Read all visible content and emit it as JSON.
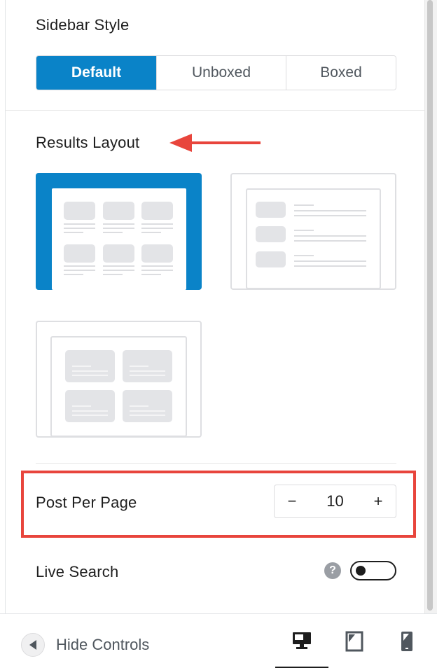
{
  "sidebar_style": {
    "label": "Sidebar Style",
    "options": [
      "Default",
      "Unboxed",
      "Boxed"
    ],
    "selected": "Default"
  },
  "results_layout": {
    "label": "Results Layout",
    "options": [
      "grid",
      "list",
      "grid-2-columns"
    ],
    "selected": "grid"
  },
  "post_per_page": {
    "label": "Post Per Page",
    "value": "10",
    "decrement": "−",
    "increment": "+"
  },
  "live_search": {
    "label": "Live Search",
    "help": "?",
    "enabled": false
  },
  "footer": {
    "hide_controls": "Hide Controls",
    "devices": [
      "desktop-icon",
      "tablet-icon",
      "mobile-icon"
    ],
    "active_device": "desktop"
  },
  "colors": {
    "accent": "#0a83c8",
    "annotation": "#e8453c",
    "placeholder": "#e3e4e7"
  }
}
